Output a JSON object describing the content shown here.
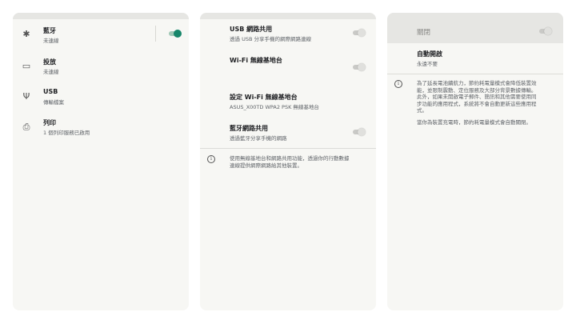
{
  "panel1": {
    "items": [
      {
        "title": "藍牙",
        "sub": "未連線",
        "icon": "bluetooth-icon",
        "glyph": "✱"
      },
      {
        "title": "投放",
        "sub": "未連線",
        "icon": "cast-icon",
        "glyph": "▭"
      },
      {
        "title": "USB",
        "sub": "傳輸檔案",
        "icon": "usb-icon",
        "glyph": "Ψ"
      },
      {
        "title": "列印",
        "sub": "1 個列印服務已啟用",
        "icon": "print-icon",
        "glyph": "⎙"
      }
    ],
    "bluetooth_toggle": "on"
  },
  "panel2": {
    "usb_tether": {
      "title": "USB 網路共用",
      "sub": "透過 USB 分享手機的網際網路連線",
      "state": "off"
    },
    "hotspot": {
      "title": "Wi-Fi 無線基地台",
      "state": "off"
    },
    "hotspot_setup": {
      "title": "設定 Wi-Fi 無線基地台",
      "sub": "ASUS_X00TD WPA2 PSK 無線基地台"
    },
    "bt_tether": {
      "title": "藍牙網路共用",
      "sub": "透過藍牙分享手機的網路",
      "state": "off"
    },
    "info_line1": "使用無線基地台和網路共用功能，透過你的行動數據",
    "info_line2": "連線提供網際網路給其他裝置。"
  },
  "panel3": {
    "header_label": "關閉",
    "header_toggle": "off",
    "auto_on": {
      "title": "自動開啟",
      "sub": "永遠不要"
    },
    "info_lines": [
      "為了延長電池續航力，節約耗電量模式會降低裝置效",
      "能，並限制震動、定位服務及大部分背景數據傳輸。",
      "此外，如果未開啟電子郵件、簡訊和其他需要使用同",
      "步功能的應用程式，系統將不會自動更新這些應用程",
      "式。"
    ],
    "info_line_charge": "當你為裝置充電時，節約耗電量模式會自動關閉。"
  }
}
